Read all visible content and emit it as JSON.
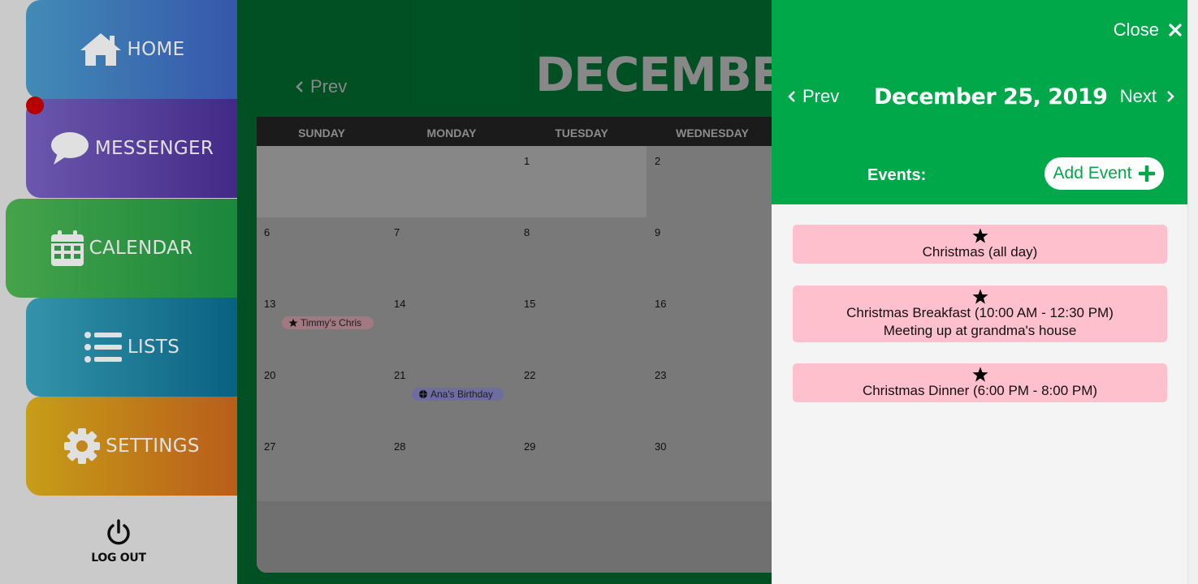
{
  "sidebar": {
    "items": [
      {
        "label": "HOME",
        "icon": "home-icon",
        "color": "#3e63c4"
      },
      {
        "label": "MESSENGER",
        "icon": "speech-bubble-icon",
        "color": "#4d2f9a",
        "has_notification": true
      },
      {
        "label": "CALENDAR",
        "icon": "calendar-icon",
        "color": "#1e9a45",
        "active": true
      },
      {
        "label": "LISTS",
        "icon": "list-icon",
        "color": "#0a6f93"
      },
      {
        "label": "SETTINGS",
        "icon": "gear-icon",
        "color": "#d36a1e"
      }
    ],
    "logout_label": "LOG OUT",
    "notification_color": "#d10000"
  },
  "calendar": {
    "month_title": "DECEMBER",
    "prev_label": "Prev",
    "weekdays": [
      "SUNDAY",
      "MONDAY",
      "TUESDAY",
      "WEDNESDAY"
    ],
    "weeks": [
      [
        {
          "day": ""
        },
        {
          "day": ""
        },
        {
          "day": "1"
        },
        {
          "day": "2"
        }
      ],
      [
        {
          "day": "6"
        },
        {
          "day": "7"
        },
        {
          "day": "8"
        },
        {
          "day": "9"
        }
      ],
      [
        {
          "day": "13",
          "event": "Timmy's Chris",
          "event_icon": "star-icon",
          "event_color": "pink"
        },
        {
          "day": "14"
        },
        {
          "day": "15"
        },
        {
          "day": "16"
        }
      ],
      [
        {
          "day": "20"
        },
        {
          "day": "21",
          "event": "Ana's Birthday",
          "event_icon": "ball-icon",
          "event_color": "purple"
        },
        {
          "day": "22"
        },
        {
          "day": "23"
        }
      ],
      [
        {
          "day": "27"
        },
        {
          "day": "28"
        },
        {
          "day": "29"
        },
        {
          "day": "30"
        }
      ]
    ]
  },
  "day_panel": {
    "close_label": "Close",
    "prev_label": "Prev",
    "next_label": "Next",
    "date": "December 25, 2019",
    "events_label": "Events:",
    "add_event_label": "Add Event",
    "accent": "#00a84a",
    "events": [
      {
        "icon": "star-icon",
        "title": "Christmas (all day)",
        "note": ""
      },
      {
        "icon": "star-icon",
        "title": "Christmas Breakfast (10:00 AM - 12:30 PM)",
        "note": "Meeting up at grandma's house"
      },
      {
        "icon": "star-icon",
        "title": "Christmas Dinner (6:00 PM - 8:00 PM)",
        "note": ""
      }
    ]
  }
}
